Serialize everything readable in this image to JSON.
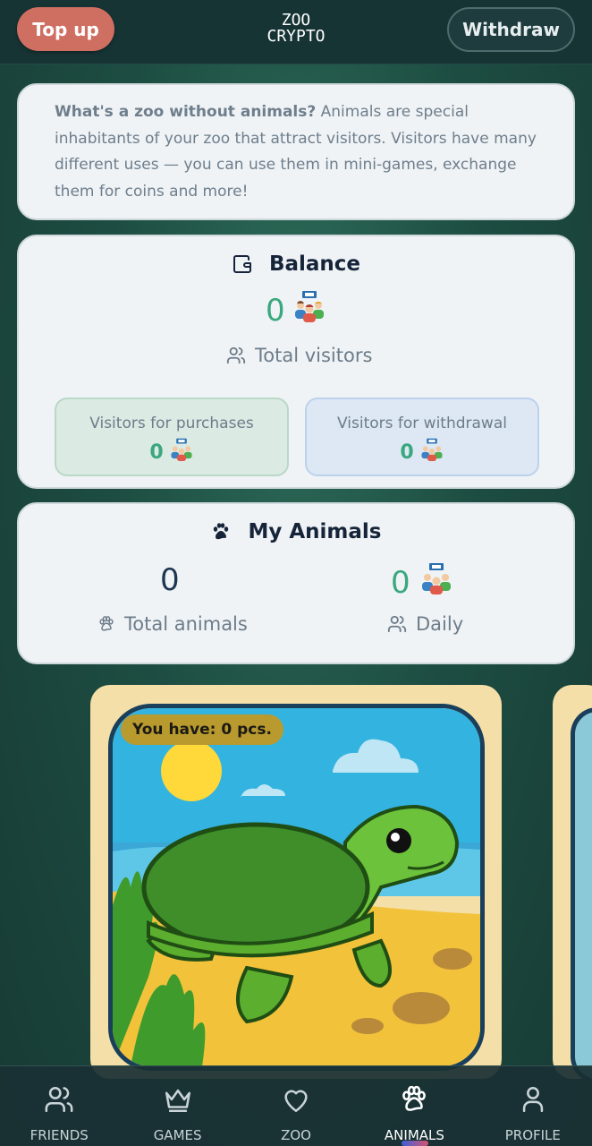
{
  "header": {
    "topup_label": "Top up",
    "logo_line1": "ZOO",
    "logo_line2": "CRYPTO",
    "withdraw_label": "Withdraw"
  },
  "intro": {
    "bold": "What's a zoo without animals?",
    "text": " Animals are special inhabitants of your zoo that attract visitors. Visitors have many different uses — you can use them in mini-games, exchange them for coins and more!"
  },
  "balance": {
    "title": "Balance",
    "total_visitors": "0",
    "total_visitors_label": "Total visitors",
    "purchases_label": "Visitors for purchases",
    "purchases_value": "0",
    "withdrawal_label": "Visitors for withdrawal",
    "withdrawal_value": "0"
  },
  "my_animals": {
    "title": "My Animals",
    "total_animals": "0",
    "total_animals_label": "Total animals",
    "daily": "0",
    "daily_label": "Daily"
  },
  "animal_card": {
    "badge": "You have: 0 pcs.",
    "image": "turtle-on-beach"
  },
  "nav": {
    "items": [
      {
        "label": "FRIENDS",
        "icon": "users-icon"
      },
      {
        "label": "GAMES",
        "icon": "crown-icon"
      },
      {
        "label": "ZOO",
        "icon": "heart-icon"
      },
      {
        "label": "ANIMALS",
        "icon": "paw-icon"
      },
      {
        "label": "PROFILE",
        "icon": "user-icon"
      }
    ],
    "active": "ANIMALS"
  },
  "colors": {
    "accent_green": "#3aa77e",
    "topup": "#cf6f62",
    "navy": "#1e3552"
  }
}
